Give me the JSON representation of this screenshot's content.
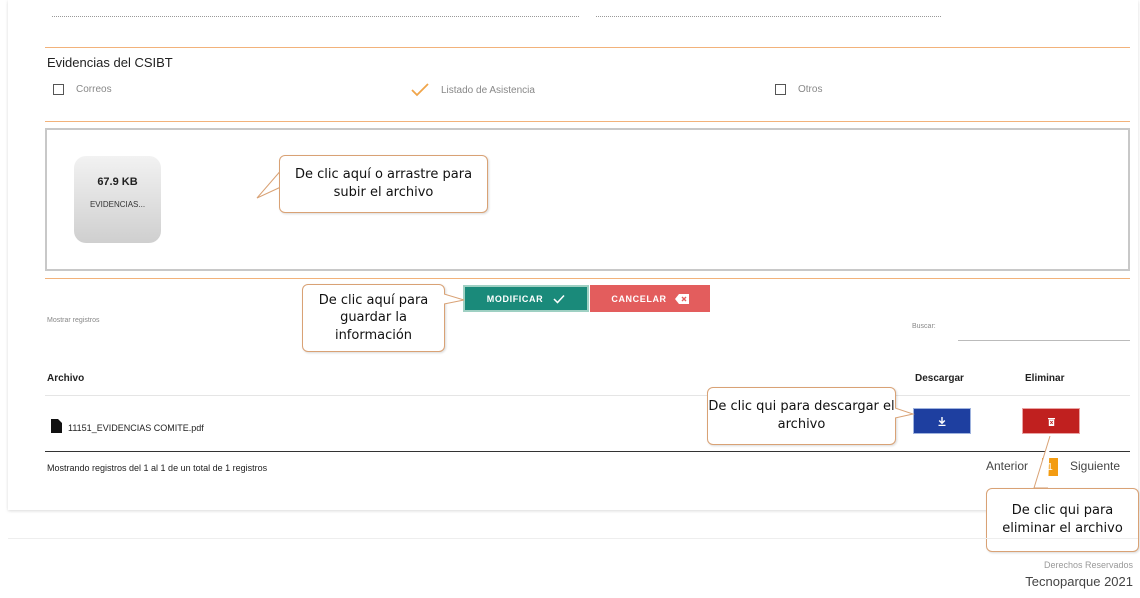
{
  "evidence": {
    "title": "Evidencias del CSIBT",
    "options": [
      {
        "label": "Correos",
        "checked": false
      },
      {
        "label": "Listado de Asistencia",
        "checked": true
      },
      {
        "label": "Otros",
        "checked": false
      }
    ]
  },
  "upload": {
    "file_size": "67.9 KB",
    "file_name": "EVIDENCIAS...",
    "callout": "De clic aquí o arrastre para subir el archivo"
  },
  "actions": {
    "modify_label": "MODIFICAR",
    "cancel_label": "CANCELAR",
    "modify_color": "#1a8a7a",
    "cancel_color": "#e35d5d",
    "save_callout": "De clic aquí para guardar la información"
  },
  "table_controls": {
    "show_records_label": "Mostrar registros",
    "search_label": "Buscar:",
    "search_value": ""
  },
  "table": {
    "headers": {
      "file": "Archivo",
      "download": "Descargar",
      "delete": "Eliminar"
    },
    "rows": [
      {
        "file": "11151_EVIDENCIAS COMITE.pdf"
      }
    ],
    "download_color": "#1e3fa0",
    "delete_color": "#c0201f",
    "download_callout": "De clic qui para descargar el archivo",
    "delete_callout": "De clic qui para eliminar el archivo"
  },
  "pagination": {
    "summary": "Mostrando registros del 1 al 1 de un total de 1 registros",
    "prev": "Anterior",
    "page": "1",
    "next": "Siguiente"
  },
  "footer": {
    "rights": "Derechos Reservados",
    "brand": "Tecnoparque 2021"
  }
}
